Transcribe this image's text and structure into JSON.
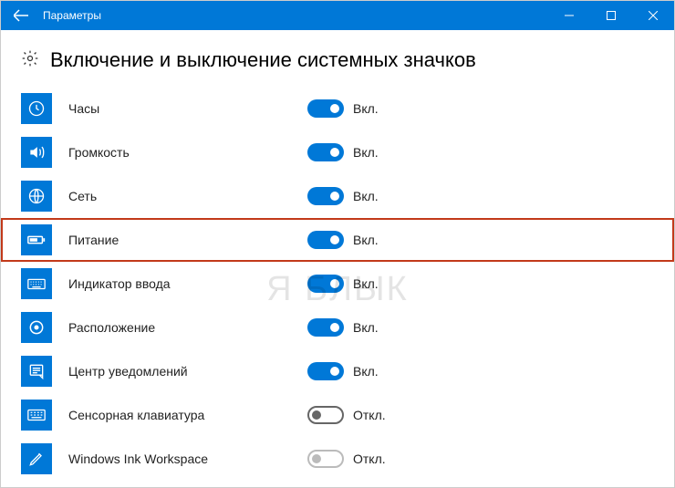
{
  "window": {
    "title": "Параметры"
  },
  "page": {
    "heading": "Включение и выключение системных значков"
  },
  "toggle_labels": {
    "on": "Вкл.",
    "off": "Откл."
  },
  "items": [
    {
      "icon": "clock",
      "label": "Часы",
      "state": "on",
      "highlighted": false,
      "enabled": true
    },
    {
      "icon": "volume",
      "label": "Громкость",
      "state": "on",
      "highlighted": false,
      "enabled": true
    },
    {
      "icon": "network",
      "label": "Сеть",
      "state": "on",
      "highlighted": false,
      "enabled": true
    },
    {
      "icon": "battery",
      "label": "Питание",
      "state": "on",
      "highlighted": true,
      "enabled": true
    },
    {
      "icon": "keyboard",
      "label": "Индикатор ввода",
      "state": "on",
      "highlighted": false,
      "enabled": true
    },
    {
      "icon": "location",
      "label": "Расположение",
      "state": "on",
      "highlighted": false,
      "enabled": true
    },
    {
      "icon": "action",
      "label": "Центр уведомлений",
      "state": "on",
      "highlighted": false,
      "enabled": true
    },
    {
      "icon": "touchkbd",
      "label": "Сенсорная клавиатура",
      "state": "off",
      "highlighted": false,
      "enabled": true
    },
    {
      "icon": "ink",
      "label": "Windows Ink Workspace",
      "state": "off",
      "highlighted": false,
      "enabled": false
    }
  ],
  "watermark": "Я БЛЫК"
}
